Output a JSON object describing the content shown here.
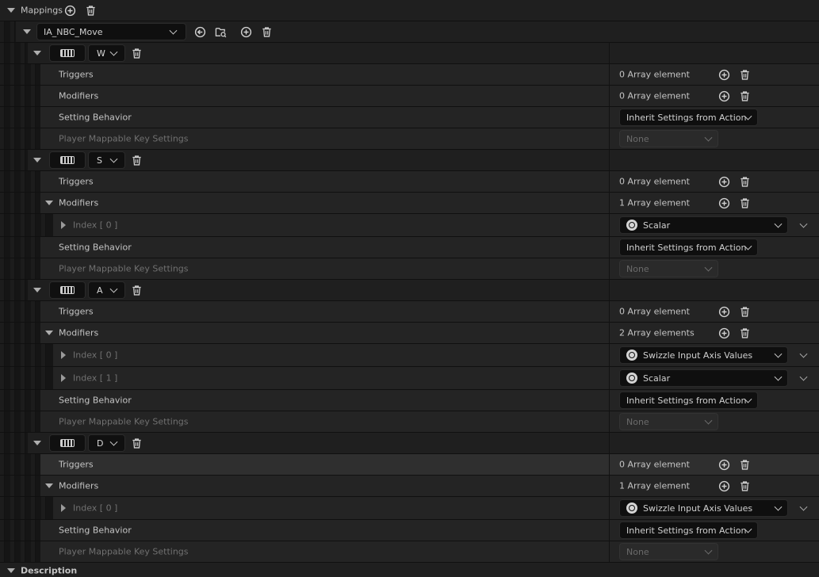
{
  "mappings": {
    "header_label": "Mappings",
    "action_name": "IA_NBC_Move",
    "keys": [
      {
        "key": "W",
        "triggers": {
          "label": "Triggers",
          "count": "0 Array element"
        },
        "modifiers": {
          "label": "Modifiers",
          "count": "0 Array element",
          "items": []
        },
        "setting_behavior": {
          "label": "Setting Behavior",
          "value": "Inherit Settings from Action"
        },
        "player_mappable": {
          "label": "Player Mappable Key Settings",
          "value": "None"
        }
      },
      {
        "key": "S",
        "triggers": {
          "label": "Triggers",
          "count": "0 Array element"
        },
        "modifiers": {
          "label": "Modifiers",
          "count": "1 Array element",
          "items": [
            {
              "index": "Index [ 0 ]",
              "value": "Scalar"
            }
          ]
        },
        "setting_behavior": {
          "label": "Setting Behavior",
          "value": "Inherit Settings from Action"
        },
        "player_mappable": {
          "label": "Player Mappable Key Settings",
          "value": "None"
        }
      },
      {
        "key": "A",
        "triggers": {
          "label": "Triggers",
          "count": "0 Array element"
        },
        "modifiers": {
          "label": "Modifiers",
          "count": "2 Array elements",
          "items": [
            {
              "index": "Index [ 0 ]",
              "value": "Swizzle Input Axis Values"
            },
            {
              "index": "Index [ 1 ]",
              "value": "Scalar"
            }
          ]
        },
        "setting_behavior": {
          "label": "Setting Behavior",
          "value": "Inherit Settings from Action"
        },
        "player_mappable": {
          "label": "Player Mappable Key Settings",
          "value": "None"
        }
      },
      {
        "key": "D",
        "triggers": {
          "label": "Triggers",
          "count": "0 Array element"
        },
        "modifiers": {
          "label": "Modifiers",
          "count": "1 Array element",
          "items": [
            {
              "index": "Index [ 0 ]",
              "value": "Swizzle Input Axis Values"
            }
          ]
        },
        "setting_behavior": {
          "label": "Setting Behavior",
          "value": "Inherit Settings from Action"
        },
        "player_mappable": {
          "label": "Player Mappable Key Settings",
          "value": "None"
        }
      }
    ]
  },
  "description": {
    "header_label": "Description"
  },
  "icons": {
    "add": "plus-circle-icon",
    "delete": "trash-icon",
    "reset": "reset-arrow-icon",
    "browse": "browse-folder-icon",
    "keyboard": "keyboard-icon",
    "modifier": "unreal-logo-icon",
    "expand": "triangle-down-icon",
    "collapse": "triangle-right-icon"
  },
  "colors": {
    "panel": "#242424",
    "header": "#1f1f1f",
    "highlight": "#2f2f2f",
    "field": "#0f0f0f"
  }
}
